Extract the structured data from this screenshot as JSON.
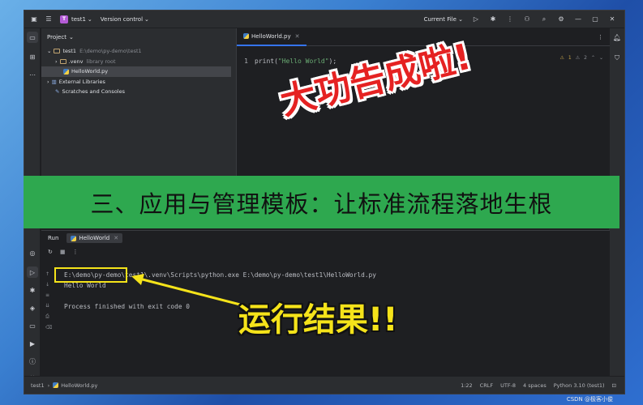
{
  "titlebar": {
    "project_letter": "T",
    "project_name": "test1",
    "vcs": "Version control",
    "run_config": "Current File"
  },
  "project_panel": {
    "title": "Project",
    "tree": [
      {
        "label": "test1",
        "extra": "E:\\demo\\py-demo\\test1"
      },
      {
        "label": ".venv",
        "extra": "library root"
      },
      {
        "label": "HelloWorld.py",
        "extra": ""
      },
      {
        "label": "External Libraries",
        "extra": ""
      },
      {
        "label": "Scratches and Consoles",
        "extra": ""
      }
    ]
  },
  "editor": {
    "tab": "HelloWorld.py",
    "line_number": "1",
    "code_prefix": "print(",
    "code_string": "\"Hello World\"",
    "code_suffix": ");",
    "inspect_warn": "1",
    "inspect_weak": "2"
  },
  "banner": {
    "text": "三、应用与管理模板：让标准流程落地生根"
  },
  "run_panel": {
    "title": "Run",
    "tab": "HelloWorld",
    "lines": [
      "E:\\demo\\py-demo\\test1\\.venv\\Scripts\\python.exe E:\\demo\\py-demo\\test1\\HelloWorld.py",
      "Hello World",
      "",
      "Process finished with exit code 0"
    ]
  },
  "statusbar": {
    "breadcrumb_project": "test1",
    "breadcrumb_file": "HelloWorld.py",
    "position": "1:22",
    "line_sep": "CRLF",
    "encoding": "UTF-8",
    "indent": "4 spaces",
    "interpreter": "Python 3.10 (test1)"
  },
  "overlays": {
    "success": "大功告成啦!",
    "result": "运行结果!!",
    "watermark": "CSDN @极客小俊"
  },
  "colors": {
    "accent": "#3574f0",
    "banner": "#2ea84f",
    "highlight": "#f5e31a",
    "success_text": "#e52222"
  }
}
